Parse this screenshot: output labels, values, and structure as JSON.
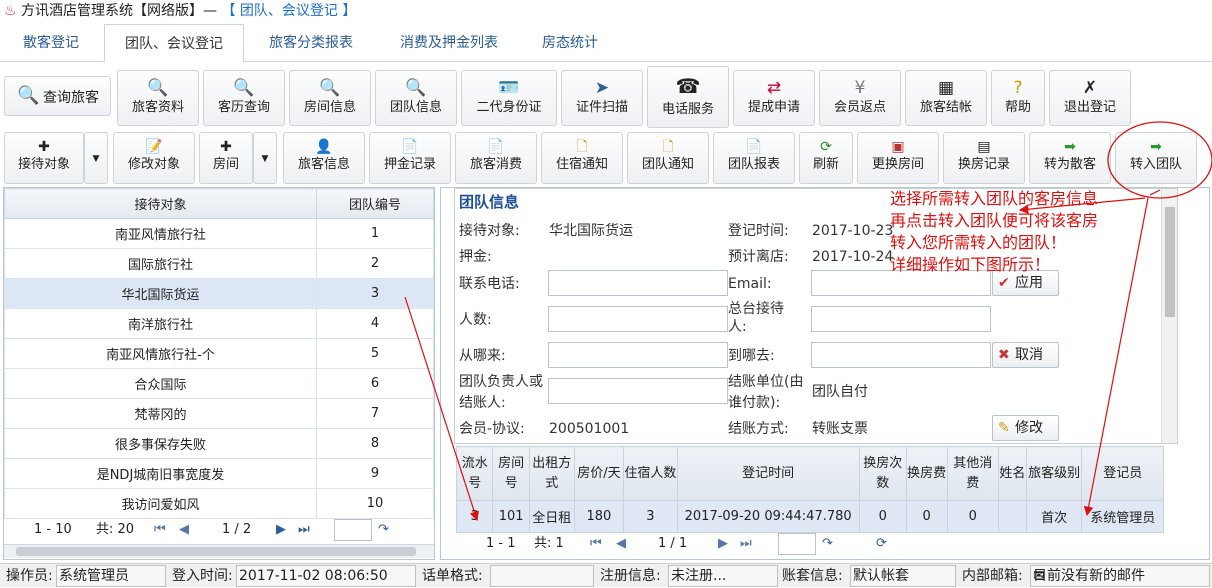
{
  "titlebar": {
    "app_title": "方讯酒店管理系统【网络版】—",
    "context": "【 团队、会议登记 】"
  },
  "tabs": [
    "散客登记",
    "团队、会议登记",
    "旅客分类报表",
    "消费及押金列表",
    "房态统计"
  ],
  "toolbar1": [
    {
      "label": "查询旅客",
      "icon": "search-icon"
    },
    {
      "label": "旅客资料",
      "icon": "search-icon"
    },
    {
      "label": "客历查询",
      "icon": "search-icon"
    },
    {
      "label": "房间信息",
      "icon": "search-icon"
    },
    {
      "label": "团队信息",
      "icon": "search-icon"
    },
    {
      "label": "二代身份证",
      "icon": "id-card-icon"
    },
    {
      "label": "证件扫描",
      "icon": "scan-icon"
    },
    {
      "label": "电话服务",
      "icon": "phone-icon"
    },
    {
      "label": "提成申请",
      "icon": "commission-icon"
    },
    {
      "label": "会员返点",
      "icon": "yen-icon"
    },
    {
      "label": "旅客结帐",
      "icon": "calculator-icon"
    },
    {
      "label": "帮助",
      "icon": "help-icon"
    },
    {
      "label": "退出登记",
      "icon": "exit-icon"
    }
  ],
  "toolbar2": [
    {
      "label": "接待对象",
      "icon": "plus-icon"
    },
    {
      "label": "修改对象",
      "icon": "edit-icon"
    },
    {
      "label": "房间",
      "icon": "plus-icon"
    },
    {
      "label": "旅客信息",
      "icon": "guest-icon"
    },
    {
      "label": "押金记录",
      "icon": "deposit-icon"
    },
    {
      "label": "旅客消费",
      "icon": "consume-icon"
    },
    {
      "label": "住宿通知",
      "icon": "notice-icon"
    },
    {
      "label": "团队通知",
      "icon": "notice-icon"
    },
    {
      "label": "团队报表",
      "icon": "report-icon"
    },
    {
      "label": "刷新",
      "icon": "refresh-icon"
    },
    {
      "label": "更换房间",
      "icon": "room-change-icon"
    },
    {
      "label": "换房记录",
      "icon": "record-icon"
    },
    {
      "label": "转为散客",
      "icon": "arrow-right-icon"
    },
    {
      "label": "转入团队",
      "icon": "arrow-right-icon"
    }
  ],
  "left_grid": {
    "headers": [
      "接待对象",
      "团队编号"
    ],
    "rows": [
      [
        "南亚风情旅行社",
        "1"
      ],
      [
        "国际旅行社",
        "2"
      ],
      [
        "华北国际货运",
        "3"
      ],
      [
        "南洋旅行社",
        "4"
      ],
      [
        "南亚风情旅行社-个",
        "5"
      ],
      [
        "合众国际",
        "6"
      ],
      [
        "梵蒂冈的",
        "7"
      ],
      [
        "很多事保存失败",
        "8"
      ],
      [
        "是NDJ城南旧事宽度发",
        "9"
      ],
      [
        "我访问爱如风",
        "10"
      ]
    ],
    "pager": {
      "range": "1 - 10",
      "total": "共: 20",
      "page": "1 / 2"
    }
  },
  "info": {
    "title": "团队信息",
    "reception_label": "接待对象:",
    "reception_value": "华北国际货运",
    "checkin_label": "登记时间:",
    "checkin_value": "2017-10-23",
    "deposit_label": "押金:",
    "leave_label": "预计离店:",
    "leave_value": "2017-10-24",
    "phone_label": "联系电话:",
    "email_label": "Email:",
    "people_label": "人数:",
    "desk_label": "总台接待人:",
    "from_label": "从哪来:",
    "to_label": "到哪去:",
    "leader_label": "团队负责人或结账人:",
    "payer_label": "结账单位(由谁付款):",
    "payer_value": "团队自付",
    "member_label": "会员-协议:",
    "member_value": "200501001",
    "paymethod_label": "结账方式:",
    "paymethod_value": "转账支票",
    "apply_btn": "应用",
    "cancel_btn": "取消",
    "modify_btn": "修改"
  },
  "annotation": {
    "lines": [
      "选择所需转入团队的客房信息",
      "再点击转入团队便可将该客房",
      "转入您所需转入的团队！",
      "详细操作如下图所示！"
    ],
    "color": "#e01010"
  },
  "bottom_grid": {
    "headers": [
      "流水号",
      "房间号",
      "出租方式",
      "房价/天",
      "住宿人数",
      "登记时间",
      "换房次数",
      "换房费",
      "其他消费",
      "姓名",
      "旅客级别",
      "登记员"
    ],
    "rows": [
      [
        "3",
        "101",
        "全日租",
        "180",
        "3",
        "2017-09-20 09:44:47.780",
        "0",
        "0",
        "0",
        "",
        "首次",
        "系统管理员"
      ]
    ],
    "pager": {
      "range": "1 - 1",
      "total": "共: 1",
      "page": "1 / 1"
    }
  },
  "statusbar": {
    "operator_label": "操作员:",
    "operator_value": "系统管理员",
    "login_label": "登入时间:",
    "login_value": "2017-11-02 08:06:50",
    "format_label": "话单格式:",
    "format_value": "",
    "reg_label": "注册信息:",
    "reg_value": "未注册...",
    "account_label": "账套信息:",
    "account_value": "默认帐套",
    "mail_label": "内部邮箱:",
    "mail_value": "目前没有新的邮件"
  }
}
